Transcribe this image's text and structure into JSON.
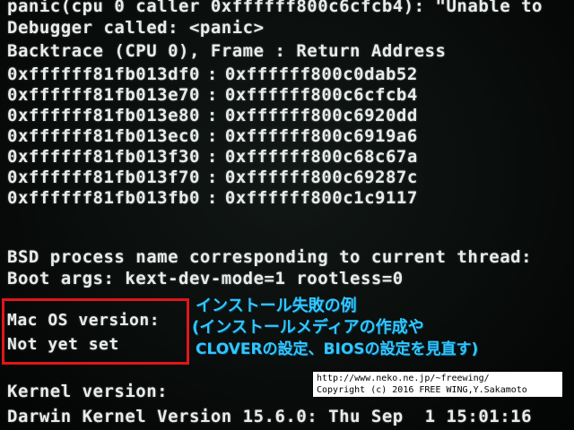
{
  "panic_line": "panic(cpu 0 caller 0xffffff800c6cfcb4): \"Unable to",
  "debugger_line": "Debugger called: <panic>",
  "backtrace_header": "Backtrace (CPU 0), Frame : Return Address",
  "backtrace": [
    {
      "frame": "0xffffff81fb013df0",
      "ret": "0xffffff800c0dab52"
    },
    {
      "frame": "0xffffff81fb013e70",
      "ret": "0xffffff800c6cfcb4"
    },
    {
      "frame": "0xffffff81fb013e80",
      "ret": "0xffffff800c6920dd"
    },
    {
      "frame": "0xffffff81fb013ec0",
      "ret": "0xffffff800c6919a6"
    },
    {
      "frame": "0xffffff81fb013f30",
      "ret": "0xffffff800c68c67a"
    },
    {
      "frame": "0xffffff81fb013f70",
      "ret": "0xffffff800c69287c"
    },
    {
      "frame": "0xffffff81fb013fb0",
      "ret": "0xffffff800c1c9117"
    }
  ],
  "separator": ":",
  "bsd_line": "BSD process name corresponding to current thread:",
  "boot_args": "Boot args: kext-dev-mode=1 rootless=0",
  "macos_version_label": "Mac OS version:",
  "macos_version_value": "Not yet set",
  "kernel_version_label": "Kernel version:",
  "darwin_line": "Darwin Kernel Version 15.6.0: Thu Sep  1 15:01:16",
  "annotation": {
    "line1": "インストール失敗の例",
    "line2": "(インストールメディアの作成や",
    "line3": "CLOVERの設定、BIOSの設定を見直す)"
  },
  "credit": {
    "url": "http://www.neko.ne.jp/~freewing/",
    "copyright": "Copyright (c) 2016 FREE WING,Y.Sakamoto"
  },
  "colors": {
    "text": "#e8ecea",
    "annotation": "#33c6ff",
    "box": "#e0161a"
  }
}
